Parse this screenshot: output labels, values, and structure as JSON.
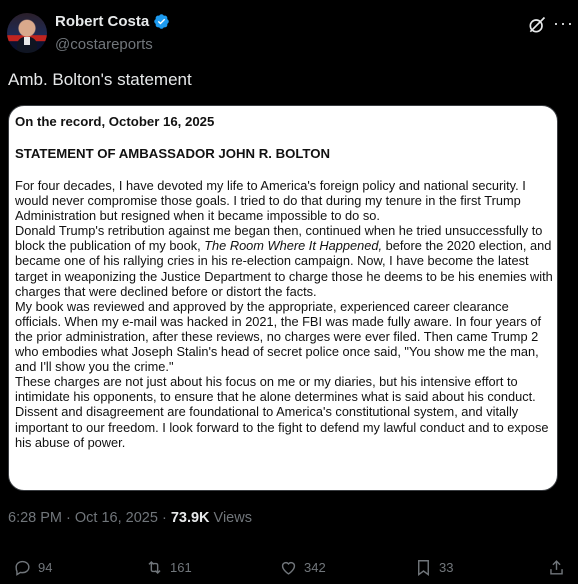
{
  "author": {
    "name": "Robert Costa",
    "handle": "@costareports"
  },
  "tweet": {
    "text": "Amb. Bolton's statement"
  },
  "statement": {
    "dateline": "On the record, October 16, 2025",
    "title": "STATEMENT OF AMBASSADOR JOHN R. BOLTON",
    "p1": "For four decades, I have devoted my life to America's foreign policy and national security. I would never compromise those goals. I tried to do that during my tenure in the first Trump Administration but resigned when it became impossible to do so.",
    "p2_before_book": "Donald Trump's retribution against me began then, continued when he tried unsuccessfully to block the publication of my book, ",
    "book_title": "The Room Where It Happened,",
    "p2_after_book": " before the 2020 election, and became one of his rallying cries in his re-election campaign. Now, I have become the latest target in weaponizing the Justice Department to charge those he deems to be his enemies with charges that were declined before or distort the facts.",
    "p3": "My book was reviewed and approved by the appropriate, experienced career clearance officials. When my e-mail was hacked in 2021, the FBI was made fully aware. In four years of the prior administration, after these reviews, no charges were ever filed. Then came Trump 2 who embodies what Joseph Stalin's head of secret police once said, \"You show me the man, and I'll show you the crime.\"",
    "p4": "These charges are not just about his focus on me or my diaries, but his intensive effort to intimidate his opponents, to ensure that he alone determines what is said about his conduct. Dissent and disagreement are foundational to America's constitutional system, and vitally important to our freedom. I look forward to the fight to defend my lawful conduct and to expose his abuse of power."
  },
  "meta": {
    "time": "6:28 PM",
    "sep": " · ",
    "date": "Oct 16, 2025",
    "views_count": "73.9K",
    "views_label": " Views"
  },
  "actions": {
    "replies": "94",
    "reposts": "161",
    "likes": "342",
    "bookmarks": "33"
  },
  "icons": [
    "verified-badge-icon",
    "grok-icon",
    "more-icon",
    "reply-icon",
    "repost-icon",
    "like-icon",
    "bookmark-icon",
    "share-icon"
  ],
  "colors": {
    "background": "#000000",
    "text": "#e7e9ea",
    "muted": "#71767b",
    "verified": "#1d9bf0",
    "card_bg": "#ffffff"
  }
}
